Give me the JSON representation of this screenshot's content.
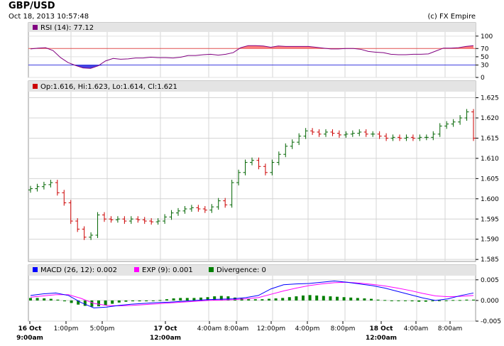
{
  "header": {
    "title": "GBP/USD",
    "datetime": "Oct 18, 2013 10:57:48",
    "copyright": "(c) FX Empire"
  },
  "chart_data": [
    {
      "type": "area",
      "legend": "RSI (14): 77.12",
      "legend_color": "#800080",
      "ylim": [
        0,
        110
      ],
      "yticks": [
        "100",
        "70",
        "50",
        "30",
        "0"
      ],
      "levels": [
        70,
        30
      ],
      "level_colors": {
        "upper": "#e05050",
        "lower": "#4040e0"
      },
      "values": [
        69,
        71,
        72,
        65,
        48,
        36,
        29,
        23,
        22,
        28,
        40,
        46,
        44,
        45,
        47,
        47,
        49,
        48,
        48,
        47,
        49,
        53,
        53,
        55,
        56,
        54,
        56,
        60,
        72,
        77,
        77,
        76,
        73,
        76,
        75,
        75,
        75,
        75,
        73,
        71,
        69,
        69,
        70,
        70,
        68,
        63,
        61,
        60,
        56,
        55,
        55,
        56,
        56,
        57,
        64,
        71,
        71,
        72,
        75,
        77
      ]
    },
    {
      "type": "ohlc",
      "legend": "Op:1.616, Hi:1.623, Lo:1.614, Cl:1.621",
      "legend_color": "#cc0000",
      "ylim": [
        1.5845,
        1.6265
      ],
      "yticks": [
        "1.625",
        "1.620",
        "1.615",
        "1.610",
        "1.605",
        "1.600",
        "1.595",
        "1.590",
        "1.585"
      ],
      "up_color": "#006400",
      "down_color": "#cc0000",
      "close": [
        1.6025,
        1.603,
        1.6035,
        1.604,
        1.6015,
        1.599,
        1.5945,
        1.5925,
        1.5905,
        1.591,
        1.596,
        1.595,
        1.5948,
        1.595,
        1.5945,
        1.595,
        1.5948,
        1.5945,
        1.5943,
        1.5945,
        1.5955,
        1.5965,
        1.597,
        1.5975,
        1.5978,
        1.5975,
        1.5972,
        1.598,
        1.5995,
        1.5985,
        1.604,
        1.6065,
        1.609,
        1.6095,
        1.608,
        1.6065,
        1.609,
        1.611,
        1.613,
        1.614,
        1.6155,
        1.6168,
        1.6165,
        1.616,
        1.6165,
        1.6162,
        1.6158,
        1.616,
        1.6162,
        1.6165,
        1.616,
        1.616,
        1.6155,
        1.615,
        1.6152,
        1.615,
        1.6152,
        1.615,
        1.6152,
        1.6152,
        1.616,
        1.618,
        1.6185,
        1.619,
        1.62,
        1.6215,
        1.615
      ]
    },
    {
      "type": "macd",
      "legend": {
        "macd": "MACD (26, 12): 0.002",
        "exp": "EXP (9): 0.001",
        "divergence": "Divergence: 0"
      },
      "colors": {
        "macd": "#0000ff",
        "exp": "#ff00ff",
        "divergence": "#008000"
      },
      "ylim": [
        -0.005,
        0.006
      ],
      "yticks": [
        "0.005",
        "0.000",
        "-0.005"
      ],
      "macd": [
        0.0012,
        0.0016,
        0.0018,
        0.0012,
        -0.0005,
        -0.0018,
        -0.0016,
        -0.0012,
        -0.0009,
        -0.0007,
        -0.0005,
        -0.0004,
        -0.0002,
        0.0,
        0.0002,
        0.0003,
        0.0004,
        0.0007,
        0.0012,
        0.0028,
        0.0038,
        0.004,
        0.0041,
        0.0044,
        0.0047,
        0.0044,
        0.004,
        0.0036,
        0.003,
        0.0022,
        0.0014,
        0.0006,
        0.0,
        0.0004,
        0.0012,
        0.0018
      ],
      "exp": [
        0.0008,
        0.0011,
        0.0014,
        0.0014,
        0.0005,
        -0.0007,
        -0.0012,
        -0.0013,
        -0.0012,
        -0.001,
        -0.0008,
        -0.0006,
        -0.0004,
        -0.0002,
        0.0,
        0.0001,
        0.0002,
        0.0004,
        0.0007,
        0.0015,
        0.0023,
        0.003,
        0.0036,
        0.004,
        0.0043,
        0.0044,
        0.0042,
        0.0039,
        0.0035,
        0.003,
        0.0024,
        0.0017,
        0.0011,
        0.0009,
        0.001,
        0.0012
      ],
      "divergence": [
        0.0006,
        0.0006,
        0.0005,
        0.0004,
        0.0002,
        -0.0002,
        -0.0006,
        -0.001,
        -0.0013,
        -0.0015,
        -0.0014,
        -0.0012,
        -0.0008,
        -0.0005,
        -0.0003,
        -0.0002,
        -0.0002,
        -0.0002,
        -0.0001,
        0.0001,
        0.0003,
        0.0005,
        0.0006,
        0.0006,
        0.0006,
        0.0007,
        0.0008,
        0.001,
        0.0011,
        0.001,
        0.0007,
        0.0005,
        0.0003,
        0.0003,
        0.0003,
        0.0004,
        0.0005,
        0.0006,
        0.0008,
        0.001,
        0.0012,
        0.0013,
        0.0012,
        0.0011,
        0.001,
        0.0009,
        0.0008,
        0.0007,
        0.0006,
        0.0005,
        0.0004,
        0.0002,
        0.0001,
        0.0,
        -0.0001,
        -0.0001,
        -0.0002,
        -0.0003,
        -0.0003,
        -0.0002,
        -0.0001,
        0.0,
        0.0001,
        0.0001,
        0.0002,
        0.0002
      ]
    }
  ],
  "x_axis": {
    "labels": [
      {
        "line1": "16 Oct",
        "line2": "9:00am",
        "bold": true
      },
      {
        "line1": "1:00pm",
        "line2": "",
        "bold": false
      },
      {
        "line1": "5:00pm",
        "line2": "",
        "bold": false
      },
      {
        "line1": "17 Oct",
        "line2": "12:00am",
        "bold": true
      },
      {
        "line1": "4:00am",
        "line2": "",
        "bold": false
      },
      {
        "line1": "8:00am",
        "line2": "",
        "bold": false
      },
      {
        "line1": "12:00pm",
        "line2": "",
        "bold": false
      },
      {
        "line1": "4:00pm",
        "line2": "",
        "bold": false
      },
      {
        "line1": "8:00pm",
        "line2": "",
        "bold": false
      },
      {
        "line1": "18 Oct",
        "line2": "12:00am",
        "bold": true
      },
      {
        "line1": "4:00am",
        "line2": "",
        "bold": false
      },
      {
        "line1": "8:00am",
        "line2": "",
        "bold": false
      }
    ]
  }
}
